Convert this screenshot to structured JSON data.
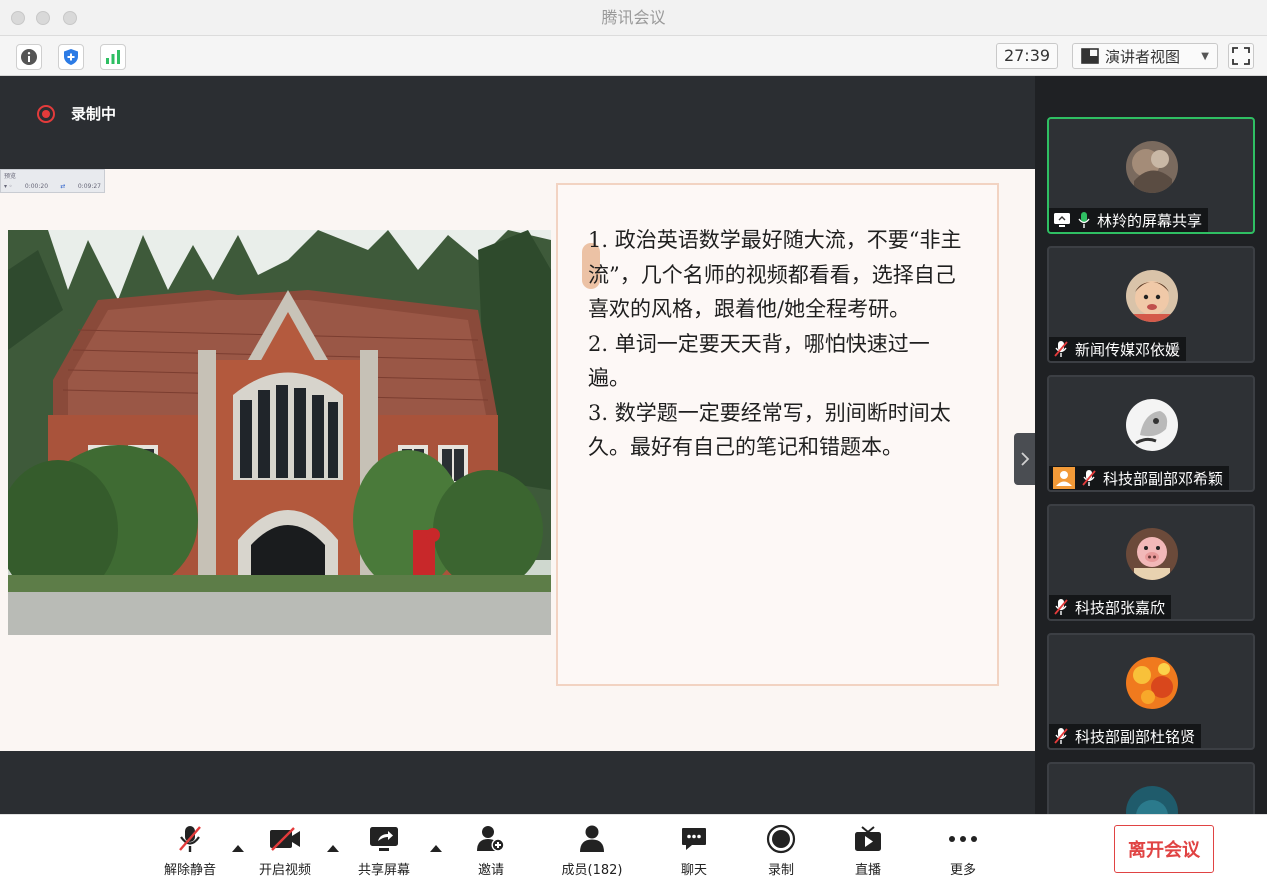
{
  "window": {
    "title": "腾讯会议"
  },
  "infobar": {
    "timer": "27:39",
    "view_mode": "演讲者视图"
  },
  "recording": {
    "label": "录制中"
  },
  "mini_player": {
    "title": "预览",
    "time_current": "0:00:20",
    "time_total": "0:09:27"
  },
  "slide": {
    "lines": [
      "1. 政治英语数学最好随大流，不要“非主流”，几个名师的视频都看看，选择自己喜欢的风格，跟着他/她全程考研。",
      "2. 单词一定要天天背，哪怕快速过一遍。",
      "3. 数学题一定要经常写，别间断时间太久。最好有自己的笔记和错题本。"
    ]
  },
  "participants": [
    {
      "name": "林羚的屏幕共享",
      "state": "sharing",
      "active": true
    },
    {
      "name": "新闻传媒邓依媛",
      "state": "muted",
      "active": false
    },
    {
      "name": "科技部副部邓希颖",
      "state": "muted",
      "active": false
    },
    {
      "name": "科技部张嘉欣",
      "state": "muted",
      "active": false
    },
    {
      "name": "科技部副部杜铭贤",
      "state": "muted",
      "active": false
    }
  ],
  "toolbar": {
    "unmute": "解除静音",
    "start_video": "开启视频",
    "share_screen": "共享屏幕",
    "invite": "邀请",
    "members": "成员(182)",
    "chat": "聊天",
    "record": "录制",
    "live": "直播",
    "more": "更多",
    "leave": "离开会议"
  },
  "colors": {
    "accent_green": "#2fbf63",
    "record_red": "#e33b3b",
    "leave_red": "#e04343",
    "info_blue": "#2c7be5"
  }
}
